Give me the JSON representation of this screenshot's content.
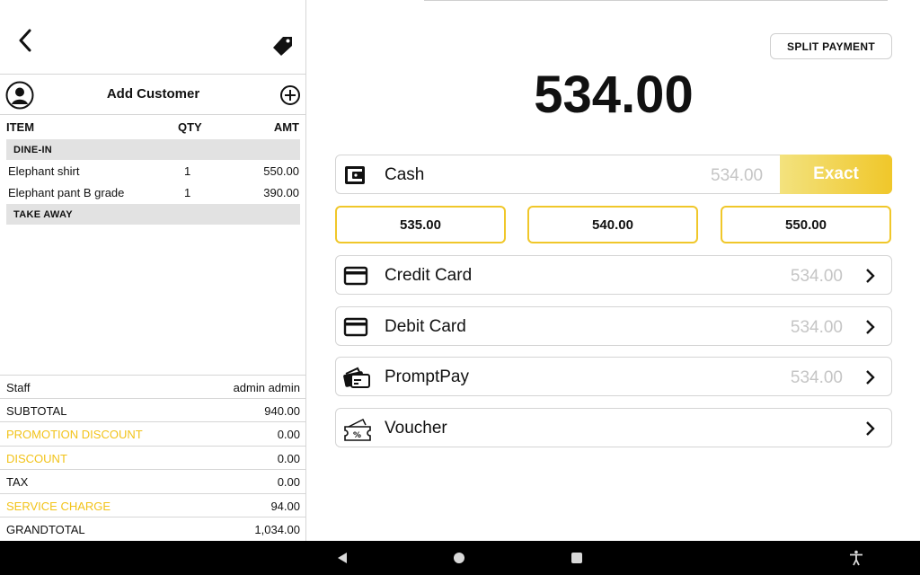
{
  "order": {
    "add_customer_label": "Add Customer",
    "columns": {
      "item": "ITEM",
      "qty": "QTY",
      "amt": "AMT"
    },
    "groups": [
      {
        "name": "DINE-IN",
        "items": [
          {
            "name": "Elephant shirt",
            "qty": "1",
            "amount": "550.00"
          },
          {
            "name": "Elephant pant B grade",
            "qty": "1",
            "amount": "390.00"
          }
        ]
      },
      {
        "name": "TAKE AWAY",
        "items": []
      }
    ]
  },
  "summary": [
    {
      "label": "Staff",
      "value": "admin admin",
      "highlight": false
    },
    {
      "label": "SUBTOTAL",
      "value": "940.00",
      "highlight": false
    },
    {
      "label": "PROMOTION DISCOUNT",
      "value": "0.00",
      "highlight": true
    },
    {
      "label": "DISCOUNT",
      "value": "0.00",
      "highlight": true
    },
    {
      "label": "TAX",
      "value": "0.00",
      "highlight": false
    },
    {
      "label": "SERVICE CHARGE",
      "value": "94.00",
      "highlight": true
    },
    {
      "label": "GRANDTOTAL",
      "value": "1,034.00",
      "highlight": false
    }
  ],
  "payment": {
    "split_label": "SPLIT PAYMENT",
    "total": "534.00",
    "cash": {
      "label": "Cash",
      "amount": "534.00",
      "exact_label": "Exact"
    },
    "quick_amounts": [
      "535.00",
      "540.00",
      "550.00"
    ],
    "methods": [
      {
        "label": "Credit Card",
        "amount": "534.00",
        "icon": "credit-card-icon"
      },
      {
        "label": "Debit Card",
        "amount": "534.00",
        "icon": "debit-card-icon"
      },
      {
        "label": "PromptPay",
        "amount": "534.00",
        "icon": "promptpay-icon"
      },
      {
        "label": "Voucher",
        "amount": "",
        "icon": "voucher-icon"
      }
    ]
  },
  "colors": {
    "accent": "#f0c72a",
    "highlight_text": "#f2c319",
    "muted": "#c5c5c5"
  }
}
